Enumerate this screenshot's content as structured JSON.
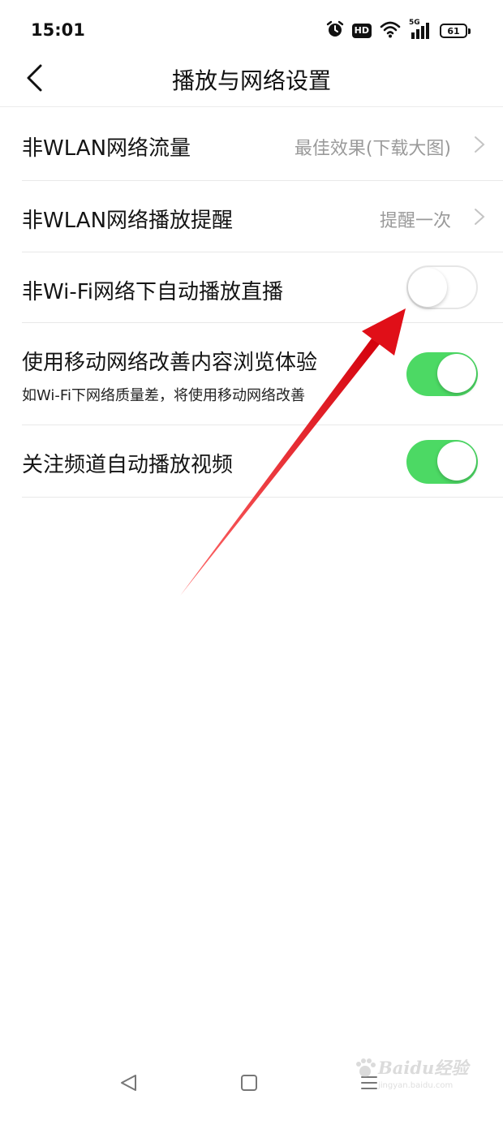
{
  "status_bar": {
    "time": "15:01",
    "hd_label": "HD",
    "network_label": "5G",
    "battery": "61",
    "icons": [
      "alarm-icon",
      "hd-icon",
      "wifi-icon",
      "5g-signal-icon",
      "battery-icon"
    ]
  },
  "header": {
    "title": "播放与网络设置",
    "back_icon": "chevron-left-icon"
  },
  "settings": [
    {
      "label": "非WLAN网络流量",
      "value": "最佳效果(下载大图)",
      "type": "chevron"
    },
    {
      "label": "非WLAN网络播放提醒",
      "value": "提醒一次",
      "type": "chevron"
    },
    {
      "label": "非Wi-Fi网络下自动播放直播",
      "type": "toggle",
      "enabled": false
    },
    {
      "label": "使用移动网络改善内容浏览体验",
      "sublabel": "如Wi-Fi下网络质量差，将使用移动网络改善",
      "type": "toggle",
      "enabled": true
    },
    {
      "label": "关注频道自动播放视频",
      "type": "toggle",
      "enabled": true
    }
  ],
  "navigation": {
    "buttons": [
      "back-triangle-icon",
      "home-square-icon",
      "menu-lines-icon"
    ]
  },
  "watermark": {
    "main": "Baidu经验",
    "sub": "jingyan.baidu.com"
  },
  "colors": {
    "toggle_on": "#4cd964",
    "toggle_off_border": "#e6e6e6",
    "annotation_arrow": "#e8141c",
    "value_text": "#9a9a9a"
  }
}
